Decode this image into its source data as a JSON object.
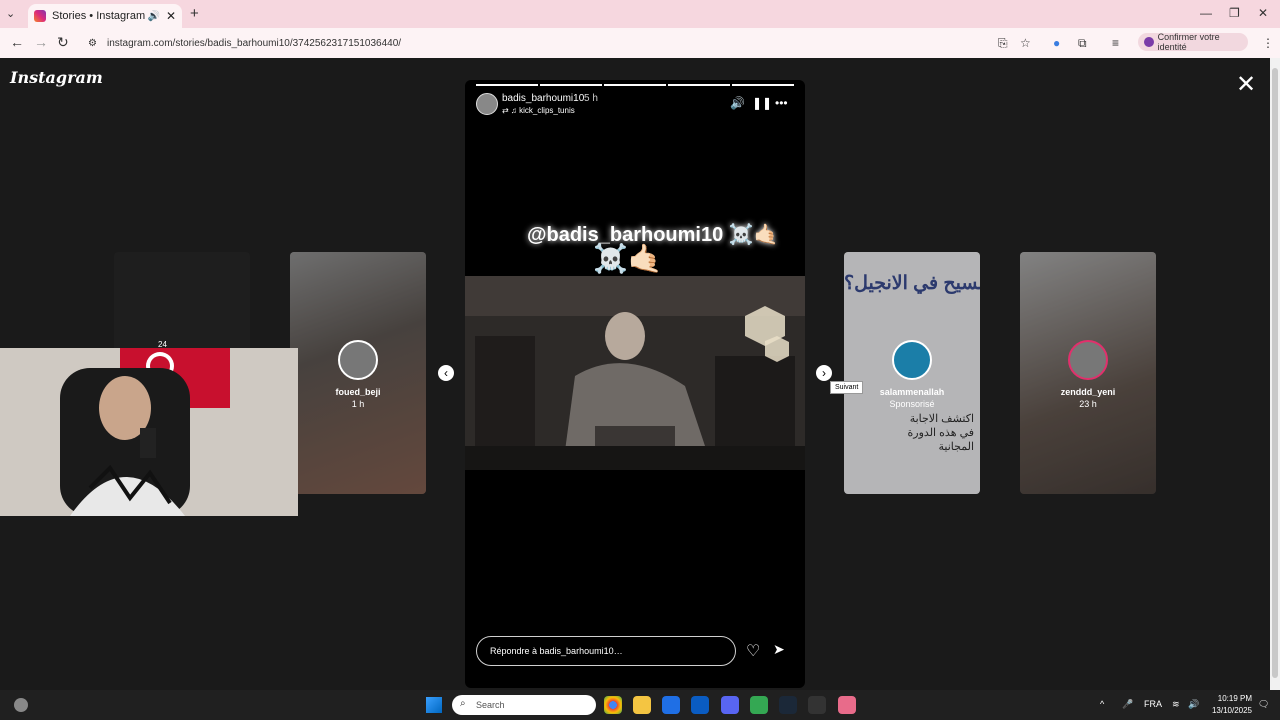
{
  "browser": {
    "tab_title": "Stories • Instagram",
    "url": "instagram.com/stories/badis_barhoumi10/3742562317151036440/",
    "profile_label": "Confirmer votre identité"
  },
  "page": {
    "logo": "Instagram",
    "story": {
      "username": "badis_barhoumi10",
      "time": "5 h",
      "shared_from": "kick_clips_tunis",
      "caption": "@badis_barhoumi10",
      "caption_emoji": "☠️🤙🏻",
      "caption_emoji_2": "☠️🤙🏻",
      "reply_placeholder": "Répondre à badis_barhoumi10…"
    },
    "left_cards": [
      {
        "username": "foued_beji",
        "time": "1 h"
      }
    ],
    "right_cards": [
      {
        "username": "salammenallah",
        "time": "Sponsorisé",
        "text": "هو المسيح في الانجيل؟",
        "subtext": "اكتشف الاجابة في هذه الدورة المجانية"
      },
      {
        "username": "zenddd_yeni",
        "time": "23 h"
      }
    ],
    "tooltip": "Suivant",
    "partial_card_label": "24"
  },
  "taskbar": {
    "search_placeholder": "Search",
    "lang": "FRA",
    "time": "10:19 PM",
    "date": "13/10/2025"
  },
  "colors": {
    "titlebar": "#f6d7df",
    "page_bg": "#1a1a1a",
    "story_bg": "#000000"
  }
}
